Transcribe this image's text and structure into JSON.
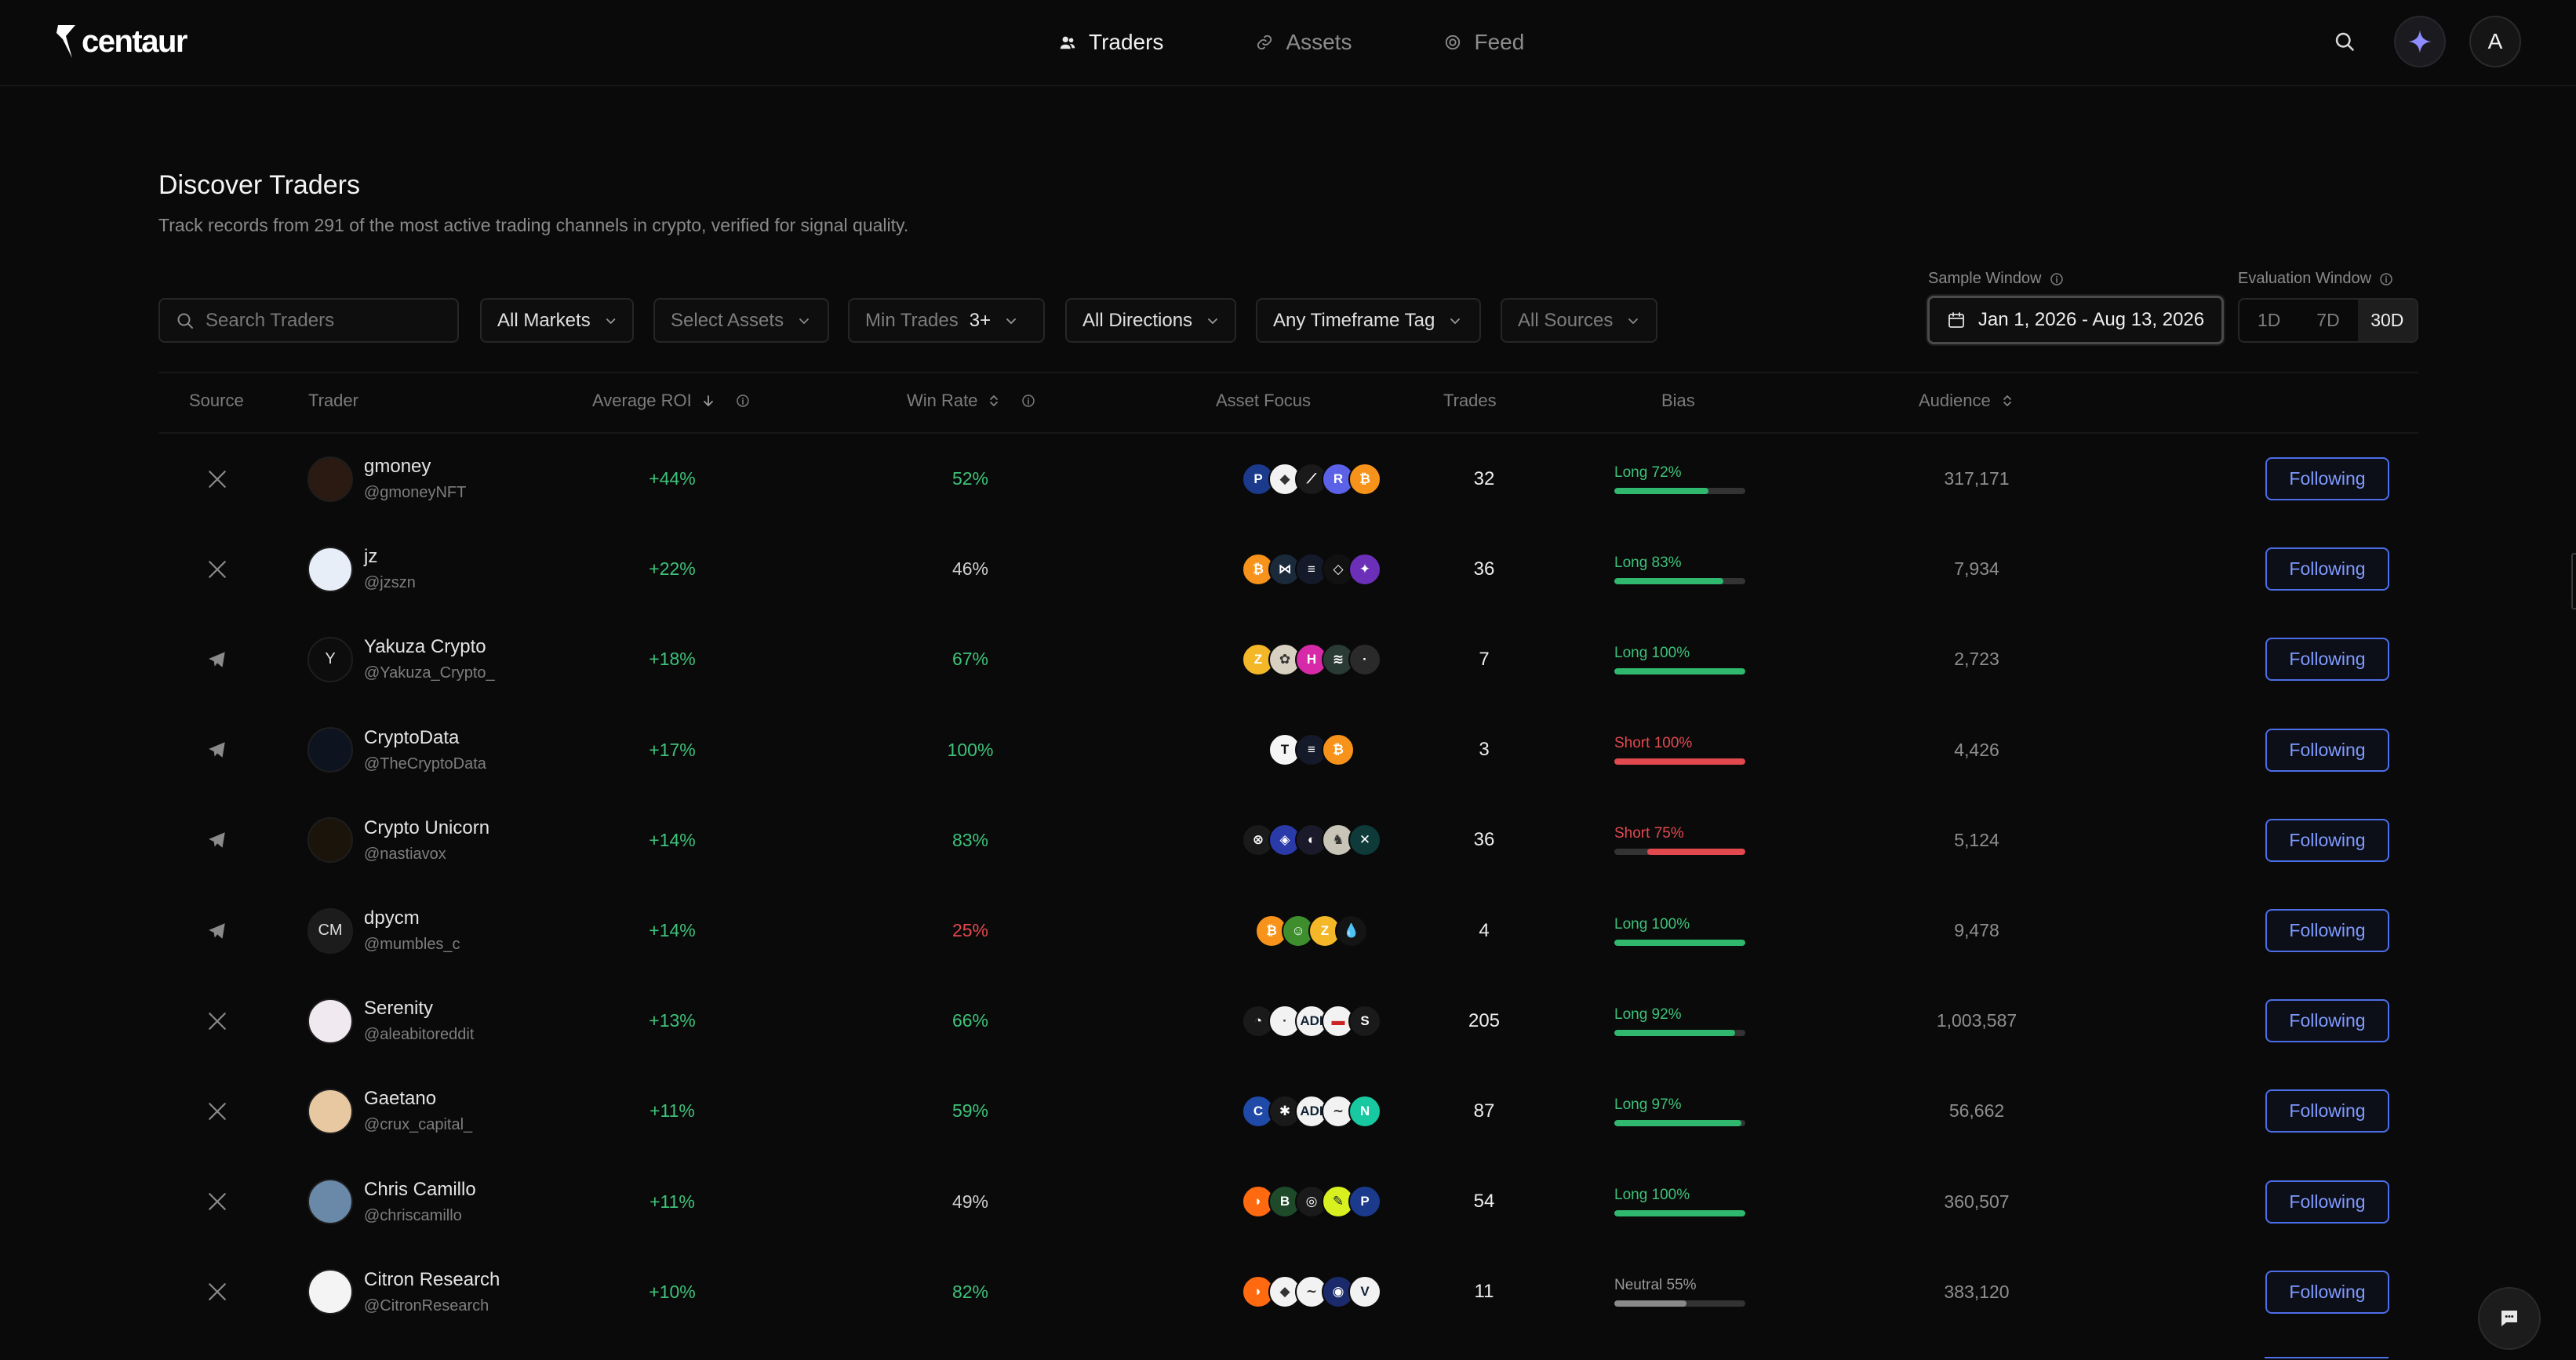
{
  "brand": {
    "name": "centaur"
  },
  "nav": {
    "tabs": [
      {
        "label": "Traders",
        "icon": "users-icon",
        "active": true
      },
      {
        "label": "Assets",
        "icon": "link-icon",
        "active": false
      },
      {
        "label": "Feed",
        "icon": "feed-icon",
        "active": false
      }
    ],
    "avatar_letter": "A"
  },
  "page": {
    "title": "Discover Traders",
    "subtitle": "Track records from 291 of the most active trading channels in crypto, verified for signal quality."
  },
  "filters": {
    "search_placeholder": "Search Traders",
    "markets": "All Markets",
    "assets": "Select Assets",
    "min_trades_label": "Min Trades",
    "min_trades_value": "3+",
    "directions": "All Directions",
    "timeframe": "Any Timeframe Tag",
    "sources": "All Sources"
  },
  "sample_window": {
    "label": "Sample Window",
    "value": "Jan 1, 2026 - Aug 13, 2026"
  },
  "evaluation_window": {
    "label": "Evaluation Window",
    "options": [
      "1D",
      "7D",
      "30D"
    ],
    "selected": "30D"
  },
  "table": {
    "headers": {
      "source": "Source",
      "trader": "Trader",
      "roi": "Average ROI",
      "win_rate": "Win Rate",
      "asset_focus": "Asset Focus",
      "trades": "Trades",
      "bias": "Bias",
      "audience": "Audience"
    },
    "rows": [
      {
        "source": "x",
        "name": "gmoney",
        "handle": "@gmoneyNFT",
        "roi": "+44%",
        "win_rate": "52%",
        "trades": "32",
        "bias": "Long 72%",
        "bias_dir": "long",
        "bias_pct": 72,
        "audience": "317,171",
        "action": "Following",
        "avatar": {
          "bg": "#2a1a12",
          "text": ""
        },
        "coins": [
          {
            "bg": "#1b3a8c",
            "t": "P"
          },
          {
            "bg": "#f2f2f2",
            "t": "◆",
            "c": "#333"
          },
          {
            "bg": "#1a1a1a",
            "t": "⟋"
          },
          {
            "bg": "#5b62e8",
            "t": "R"
          },
          {
            "bg": "#f7931a",
            "t": "₿"
          }
        ]
      },
      {
        "source": "x",
        "name": "jz",
        "handle": "@jzszn",
        "roi": "+22%",
        "win_rate": "46%",
        "trades": "36",
        "bias": "Long 83%",
        "bias_dir": "long",
        "bias_pct": 83,
        "audience": "7,934",
        "action": "Following",
        "avatar": {
          "bg": "#e8eef8",
          "text": ""
        },
        "coins": [
          {
            "bg": "#f7931a",
            "t": "₿"
          },
          {
            "bg": "#1b2a3a",
            "t": "⋈"
          },
          {
            "bg": "#141a2a",
            "t": "≡"
          },
          {
            "bg": "#111",
            "t": "◇"
          },
          {
            "bg": "#6b2fb8",
            "t": "✦"
          }
        ]
      },
      {
        "source": "telegram",
        "name": "Yakuza Crypto",
        "handle": "@Yakuza_Crypto_",
        "roi": "+18%",
        "win_rate": "67%",
        "trades": "7",
        "bias": "Long 100%",
        "bias_dir": "long",
        "bias_pct": 100,
        "audience": "2,723",
        "action": "Following",
        "avatar": {
          "bg": "#0d0d0d",
          "text": "Y"
        },
        "coins": [
          {
            "bg": "#f4b728",
            "t": "Z"
          },
          {
            "bg": "#d8d0c0",
            "t": "✿",
            "c": "#333"
          },
          {
            "bg": "#d72aa8",
            "t": "H"
          },
          {
            "bg": "#2a3a34",
            "t": "≋"
          },
          {
            "bg": "#2a2a2a",
            "t": "·"
          }
        ]
      },
      {
        "source": "telegram",
        "name": "CryptoData",
        "handle": "@TheCryptoData",
        "roi": "+17%",
        "win_rate": "100%",
        "trades": "3",
        "bias": "Short 100%",
        "bias_dir": "short",
        "bias_pct": 100,
        "audience": "4,426",
        "action": "Following",
        "avatar": {
          "bg": "#0d1420",
          "text": ""
        },
        "coins": [
          {
            "bg": "#f5f5f5",
            "t": "T",
            "c": "#111"
          },
          {
            "bg": "#141a2a",
            "t": "≡"
          },
          {
            "bg": "#f7931a",
            "t": "₿"
          }
        ]
      },
      {
        "source": "telegram",
        "name": "Crypto Unicorn",
        "handle": "@nastiavox",
        "roi": "+14%",
        "win_rate": "83%",
        "trades": "36",
        "bias": "Short 75%",
        "bias_dir": "short",
        "bias_pct": 75,
        "audience": "5,124",
        "action": "Following",
        "avatar": {
          "bg": "#1a140a",
          "text": ""
        },
        "coins": [
          {
            "bg": "#1a1a1a",
            "t": "⊗"
          },
          {
            "bg": "#2a3aa8",
            "t": "◈"
          },
          {
            "bg": "#1a1a2a",
            "t": "◐"
          },
          {
            "bg": "#c8c4b8",
            "t": "♞",
            "c": "#333"
          },
          {
            "bg": "#0e3a3a",
            "t": "✕"
          }
        ]
      },
      {
        "source": "telegram",
        "name": "dpycm",
        "handle": "@mumbles_c",
        "roi": "+14%",
        "win_rate": "25%",
        "trades": "4",
        "bias": "Long 100%",
        "bias_dir": "long",
        "bias_pct": 100,
        "audience": "9,478",
        "action": "Following",
        "avatar": {
          "bg": "#1c1c1c",
          "text": "CM"
        },
        "coins": [
          {
            "bg": "#f7931a",
            "t": "₿"
          },
          {
            "bg": "#3e8e2e",
            "t": "☺"
          },
          {
            "bg": "#f4b728",
            "t": "Z"
          },
          {
            "bg": "#141414",
            "t": "💧"
          }
        ]
      },
      {
        "source": "x",
        "name": "Serenity",
        "handle": "@aleabitoreddit",
        "roi": "+13%",
        "win_rate": "66%",
        "trades": "205",
        "bias": "Long 92%",
        "bias_dir": "long",
        "bias_pct": 92,
        "audience": "1,003,587",
        "action": "Following",
        "avatar": {
          "bg": "#f0eaf0",
          "text": ""
        },
        "coins": [
          {
            "bg": "#1a1a1a",
            "t": "◔"
          },
          {
            "bg": "#f2f2f2",
            "t": "·",
            "c": "#333"
          },
          {
            "bg": "#f2f2f2",
            "t": "ADI",
            "c": "#123"
          },
          {
            "bg": "#f2f2f2",
            "t": "▬",
            "c": "#c22"
          },
          {
            "bg": "#1a1a1a",
            "t": "S"
          }
        ]
      },
      {
        "source": "x",
        "name": "Gaetano",
        "handle": "@crux_capital_",
        "roi": "+11%",
        "win_rate": "59%",
        "trades": "87",
        "bias": "Long 97%",
        "bias_dir": "long",
        "bias_pct": 97,
        "audience": "56,662",
        "action": "Following",
        "avatar": {
          "bg": "#e8c8a0",
          "text": ""
        },
        "coins": [
          {
            "bg": "#1f4aa8",
            "t": "C"
          },
          {
            "bg": "#1a1a1a",
            "t": "✱"
          },
          {
            "bg": "#f2f2f2",
            "t": "ADI",
            "c": "#123"
          },
          {
            "bg": "#f2f2f2",
            "t": "∼",
            "c": "#333"
          },
          {
            "bg": "#18c8a0",
            "t": "N"
          }
        ]
      },
      {
        "source": "x",
        "name": "Chris Camillo",
        "handle": "@chriscamillo",
        "roi": "+11%",
        "win_rate": "49%",
        "trades": "54",
        "bias": "Long 100%",
        "bias_dir": "long",
        "bias_pct": 100,
        "audience": "360,507",
        "action": "Following",
        "avatar": {
          "bg": "#6a88a8",
          "text": ""
        },
        "coins": [
          {
            "bg": "#ff6a10",
            "t": "◗"
          },
          {
            "bg": "#1e4a2a",
            "t": "B"
          },
          {
            "bg": "#1a1a1a",
            "t": "◎"
          },
          {
            "bg": "#d8f020",
            "t": "✎",
            "c": "#123"
          },
          {
            "bg": "#1b3a8c",
            "t": "P"
          }
        ]
      },
      {
        "source": "x",
        "name": "Citron Research",
        "handle": "@CitronResearch",
        "roi": "+10%",
        "win_rate": "82%",
        "trades": "11",
        "bias": "Neutral 55%",
        "bias_dir": "neutral",
        "bias_pct": 55,
        "audience": "383,120",
        "action": "Following",
        "avatar": {
          "bg": "#f4f4f4",
          "text": ""
        },
        "coins": [
          {
            "bg": "#ff6a10",
            "t": "◗"
          },
          {
            "bg": "#f2f2f2",
            "t": "◆",
            "c": "#333"
          },
          {
            "bg": "#f2f2f2",
            "t": "∼",
            "c": "#333"
          },
          {
            "bg": "#1b2a6a",
            "t": "◉"
          },
          {
            "bg": "#f2f2f2",
            "t": "V",
            "c": "#123"
          }
        ]
      }
    ]
  },
  "colors": {
    "positive": "#3ec27a",
    "negative": "#e2494f",
    "neutral_text": "#cfcfcf",
    "long_fill": "#2fb86e",
    "short_fill": "#e2494f",
    "neutral_fill": "#8a8a8a",
    "accent": "#4c6ee8"
  }
}
